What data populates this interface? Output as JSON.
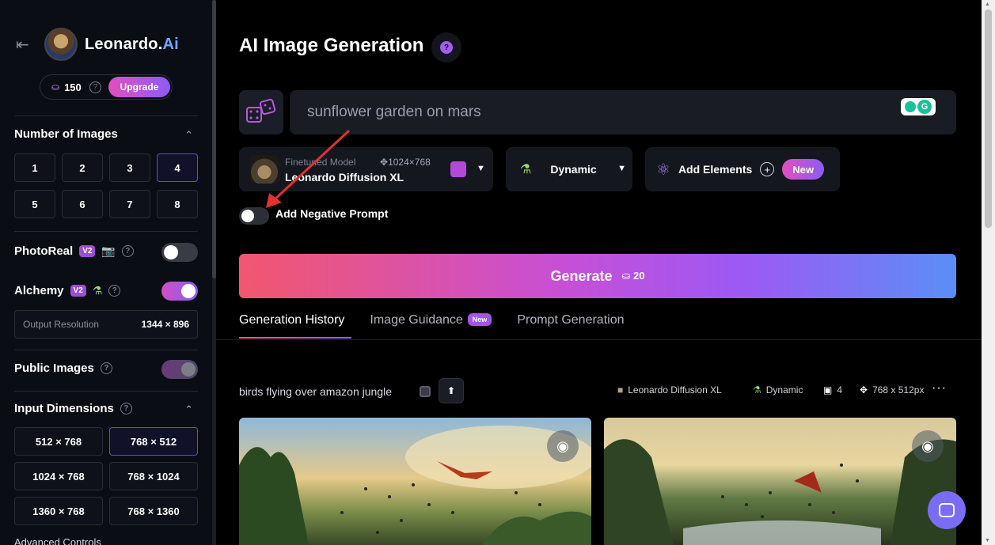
{
  "sidebar": {
    "brand_name": "Leonardo.",
    "brand_suffix": "Ai",
    "tokens": "150",
    "upgrade_label": "Upgrade",
    "number_of_images": {
      "title": "Number of Images",
      "options": [
        "1",
        "2",
        "3",
        "4",
        "5",
        "6",
        "7",
        "8"
      ],
      "selected": "4"
    },
    "photoreal": {
      "label": "PhotoReal",
      "badge": "V2",
      "enabled": false
    },
    "alchemy": {
      "label": "Alchemy",
      "badge": "V2",
      "enabled": true
    },
    "output_resolution": {
      "label": "Output Resolution",
      "value": "1344 × 896"
    },
    "public_images": {
      "label": "Public Images",
      "enabled": true
    },
    "input_dimensions": {
      "title": "Input Dimensions",
      "options": [
        "512 × 768",
        "768 × 512",
        "1024 × 768",
        "768 × 1024",
        "1360 × 768",
        "768 × 1360"
      ],
      "selected": "768 × 512"
    },
    "advanced_controls": "Advanced Controls"
  },
  "main": {
    "title": "AI Image Generation",
    "help_glyph": "?",
    "prompt_text": "sunflower garden on mars",
    "model": {
      "subtitle": "Finetuned Model",
      "dimensions": "1024×768",
      "name": "Leonardo Diffusion XL"
    },
    "style_label": "Dynamic",
    "elements_label": "Add Elements",
    "elements_new": "New",
    "negative_prompt_label": "Add Negative Prompt",
    "negative_prompt_enabled": false,
    "generate_label": "Generate",
    "generate_cost": "20",
    "tabs": [
      {
        "label": "Generation History",
        "active": true
      },
      {
        "label": "Image Guidance",
        "badge": "New"
      },
      {
        "label": "Prompt Generation"
      }
    ],
    "generation": {
      "prompt": "birds flying over amazon jungle",
      "model": "Leonardo Diffusion XL",
      "style": "Dynamic",
      "count": "4",
      "size": "768 x 512px"
    }
  },
  "colors": {
    "accent_pink": "#e24fbf",
    "accent_purple": "#8b5cf6",
    "annotation_red": "#e0312f"
  }
}
